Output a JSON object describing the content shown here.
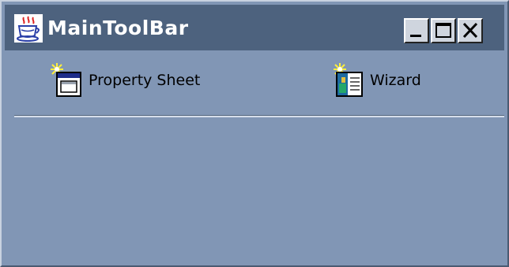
{
  "window": {
    "title": "MainToolBar",
    "app_icon": "java-cup-icon"
  },
  "title_controls": {
    "minimize_icon": "minimize-icon",
    "maximize_icon": "maximize-icon",
    "close_icon": "close-icon"
  },
  "toolbar": {
    "items": [
      {
        "label": "Property Sheet",
        "icon": "new-property-sheet-icon"
      },
      {
        "label": "Wizard",
        "icon": "new-wizard-icon"
      }
    ]
  },
  "colors": {
    "window_background": "#8196b5",
    "titlebar_background": "#4d627e",
    "title_text": "#ffffff",
    "control_button_face": "#cfd5de"
  }
}
